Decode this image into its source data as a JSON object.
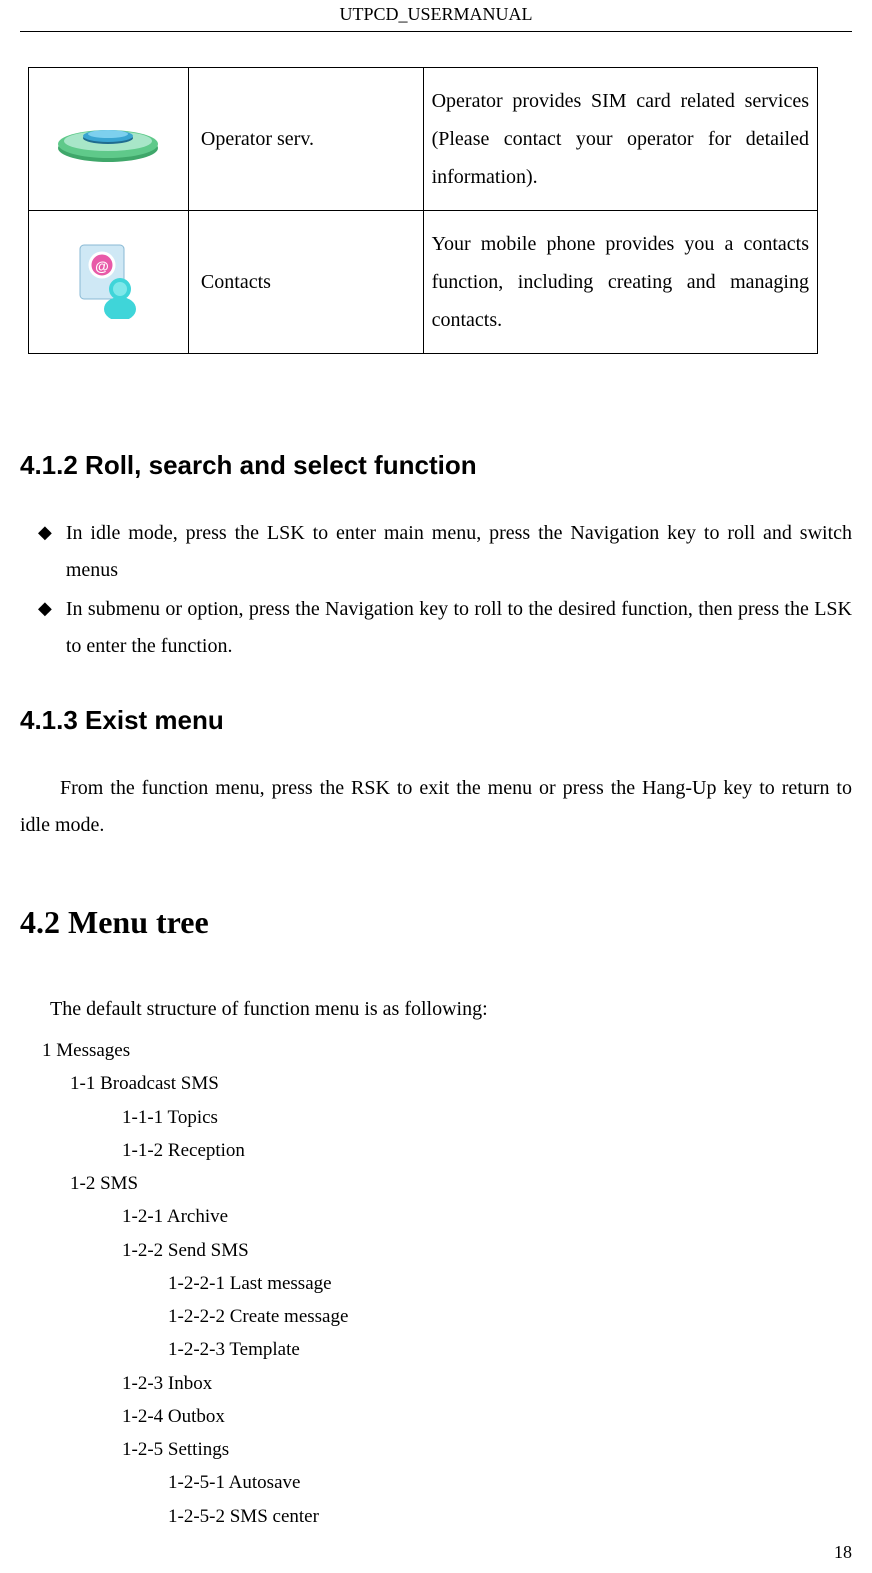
{
  "header": "UTPCD_USERMANUAL",
  "table": {
    "rows": [
      {
        "label": "Operator serv.",
        "desc": "Operator provides SIM card related services (Please contact your operator for detailed information)."
      },
      {
        "label": "Contacts",
        "desc": "Your mobile phone provides you a contacts function, including creating and managing contacts."
      }
    ]
  },
  "section412": {
    "title": "4.1.2 Roll, search and select function",
    "bullets": [
      "In idle mode, press the LSK to enter main menu, press the Navigation key to roll and switch menus",
      "In submenu or option, press the Navigation key to roll to the desired function, then press the LSK to enter the function."
    ]
  },
  "section413": {
    "title": "4.1.3 Exist menu",
    "paragraph": "From the function menu, press the RSK to exit the menu or press the Hang-Up key to return to idle mode."
  },
  "section42": {
    "title": "4.2 Menu tree",
    "intro": "The default structure of function menu is as following:",
    "tree": [
      {
        "level": 0,
        "text": "1    Messages"
      },
      {
        "level": 1,
        "text": "1-1 Broadcast SMS"
      },
      {
        "level": 2,
        "text": "1-1-1 Topics"
      },
      {
        "level": 2,
        "text": "1-1-2 Reception"
      },
      {
        "level": 1,
        "text": "1-2 SMS"
      },
      {
        "level": 2,
        "text": "1-2-1 Archive"
      },
      {
        "level": 2,
        "text": "1-2-2 Send SMS"
      },
      {
        "level": 3,
        "text": "1-2-2-1 Last message"
      },
      {
        "level": 3,
        "text": "1-2-2-2 Create message"
      },
      {
        "level": 3,
        "text": "1-2-2-3 Template"
      },
      {
        "level": 2,
        "text": "1-2-3 Inbox"
      },
      {
        "level": 2,
        "text": "1-2-4 Outbox"
      },
      {
        "level": 2,
        "text": "1-2-5 Settings"
      },
      {
        "level": 3,
        "text": "1-2-5-1 Autosave"
      },
      {
        "level": 3,
        "text": "1-2-5-2 SMS center"
      }
    ]
  },
  "pageNumber": "18"
}
